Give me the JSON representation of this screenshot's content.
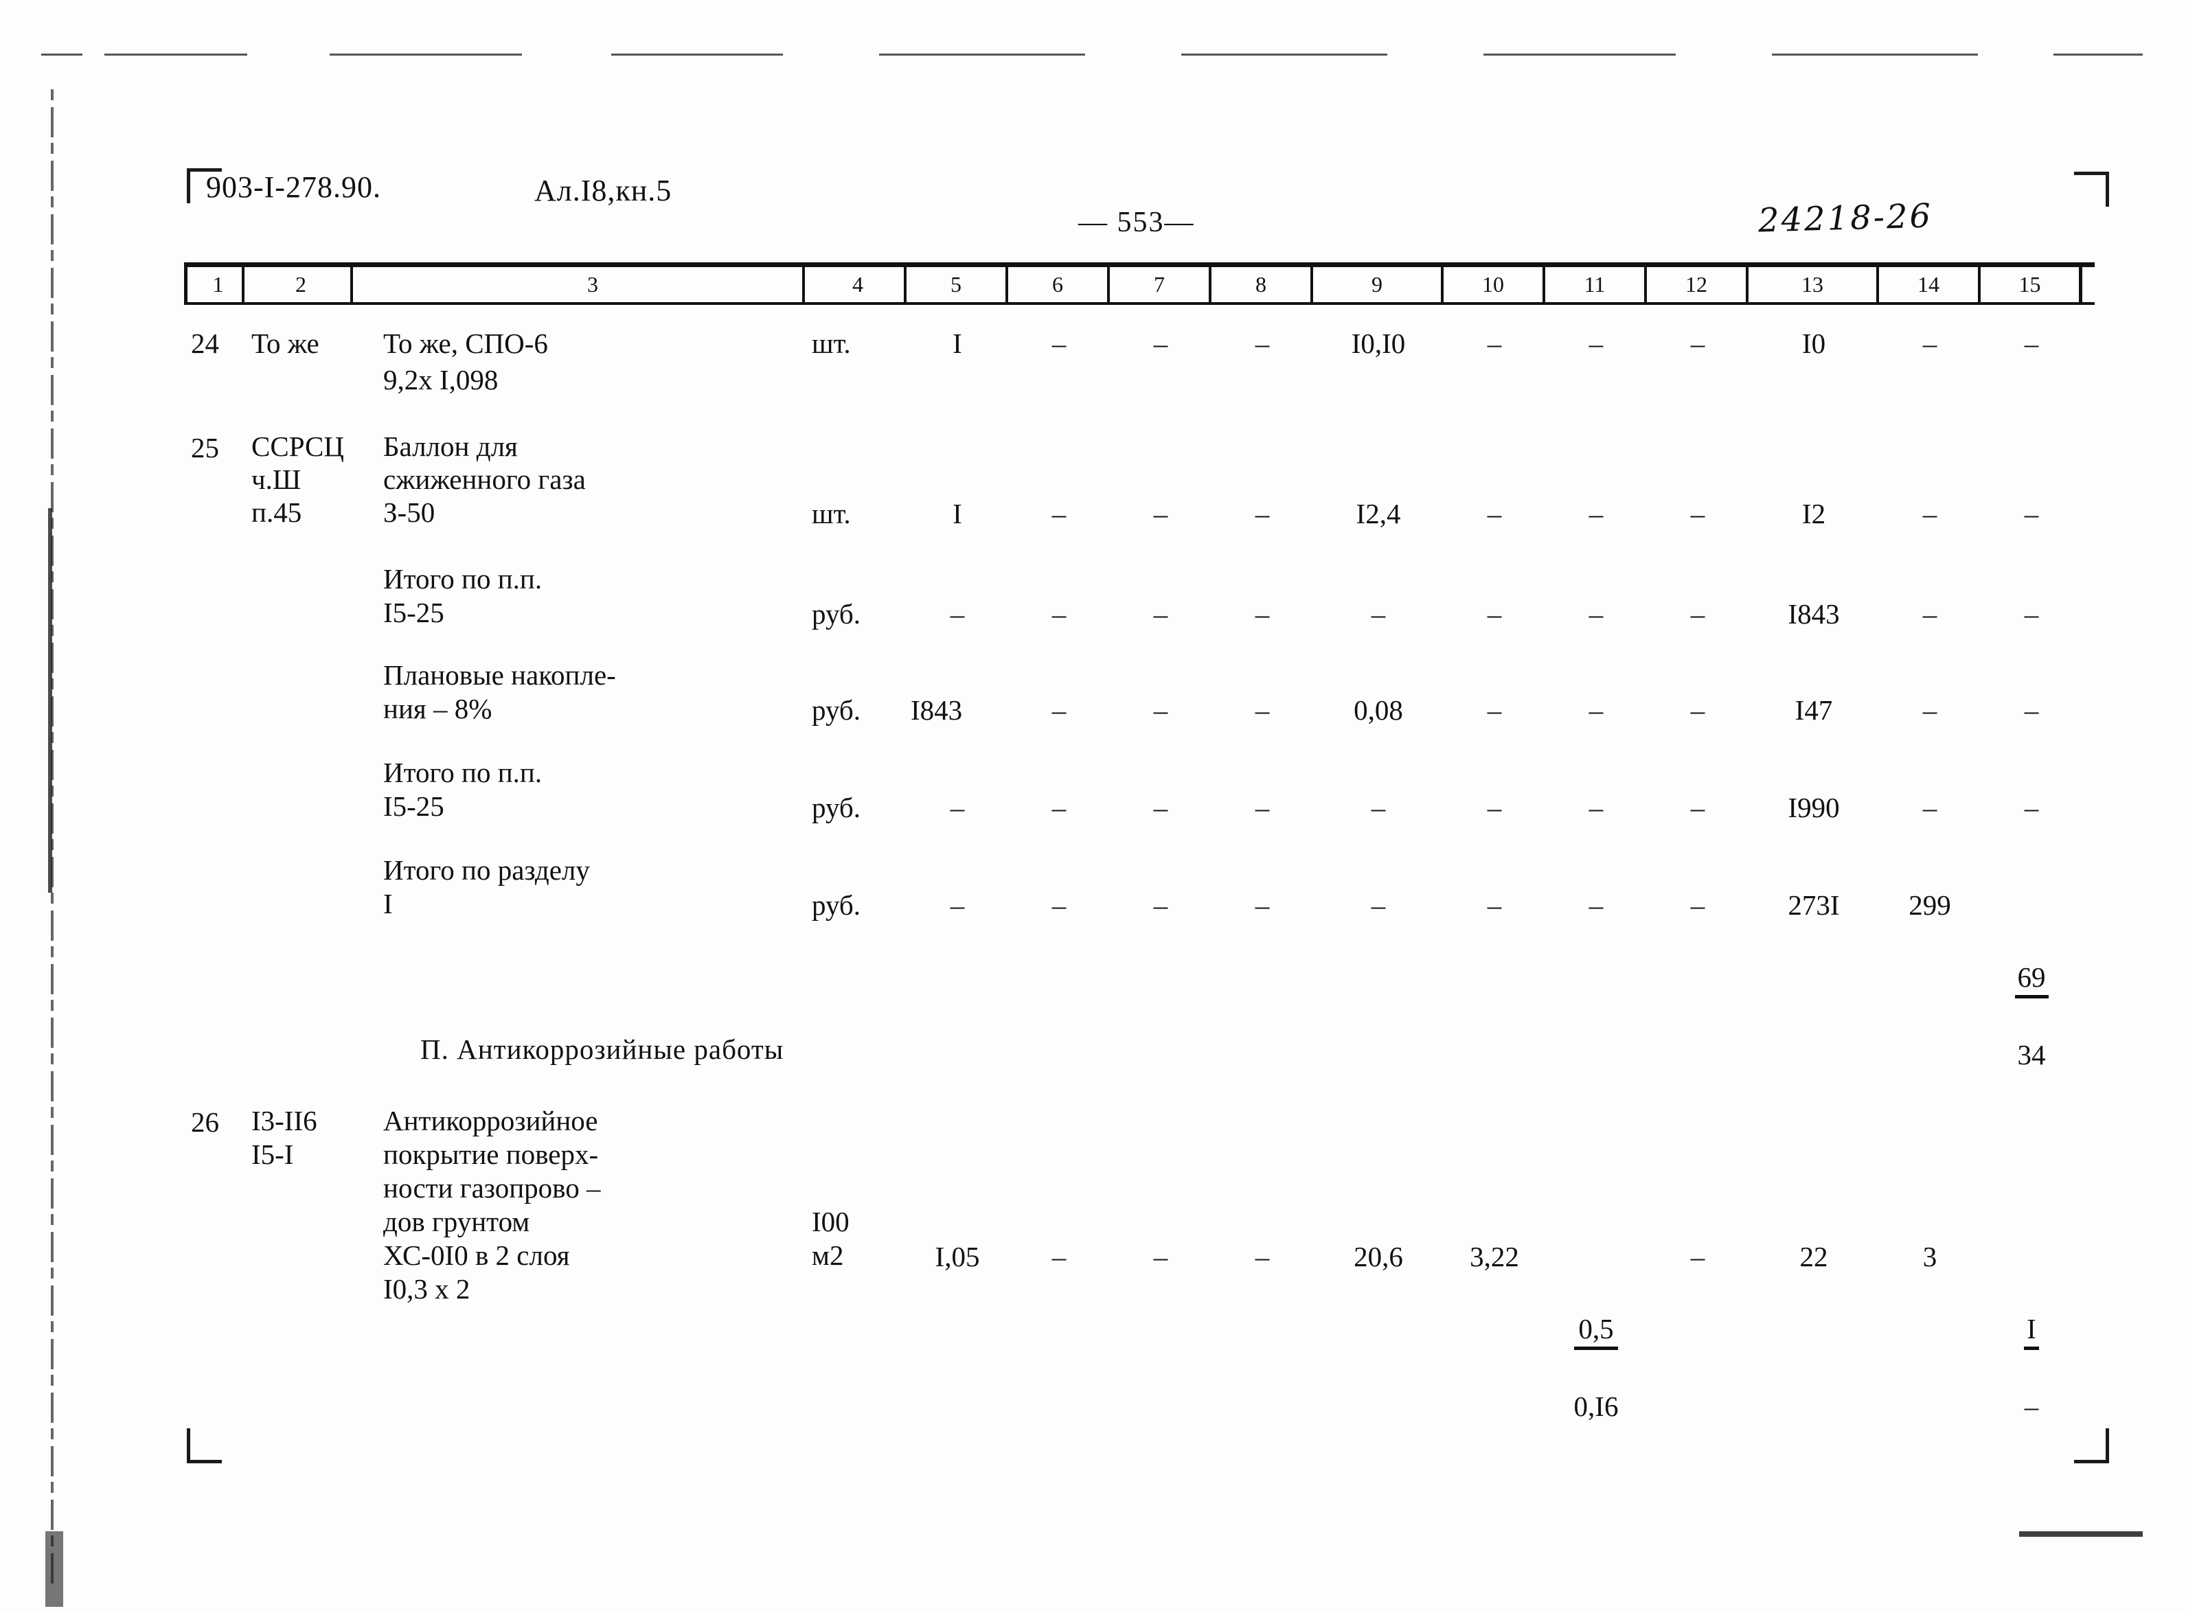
{
  "header": {
    "doc_code": "903-I-278.90.",
    "album_ref": "Ал.I8,кн.5",
    "page_number": "— 553—",
    "archive_number": "24218-26"
  },
  "table": {
    "column_headers": [
      "1",
      "2",
      "3",
      "4",
      "5",
      "6",
      "7",
      "8",
      "9",
      "10",
      "11",
      "12",
      "13",
      "14",
      "15"
    ],
    "rows": [
      {
        "name": "row-24",
        "c1": "24",
        "c2": "То же",
        "c3": "То же, СПО-6\n  9,2х I,098",
        "c4": "шт.",
        "c5": "I",
        "c6": "–",
        "c7": "–",
        "c8": "–",
        "c9": "I0,I0",
        "c10": "–",
        "c11": "–",
        "c12": "–",
        "c13": "I0",
        "c14": "–",
        "c15": "–"
      },
      {
        "name": "row-25",
        "c1": "25",
        "c2": "ССРСЦ\nч.Ш\nп.45",
        "c3": "Баллон для\nсжиженного газа\nЗ-50",
        "c4": "шт.",
        "c5": "I",
        "c6": "–",
        "c7": "–",
        "c8": "–",
        "c9": "I2,4",
        "c10": "–",
        "c11": "–",
        "c12": "–",
        "c13": "I2",
        "c14": "–",
        "c15": "–"
      },
      {
        "name": "row-itogo-15-25-a",
        "c1": "",
        "c2": "",
        "c3": "Итого по п.п.\n    I5-25",
        "c4": "руб.",
        "c5": "–",
        "c6": "–",
        "c7": "–",
        "c8": "–",
        "c9": "–",
        "c10": "–",
        "c11": "–",
        "c12": "–",
        "c13": "I843",
        "c14": "–",
        "c15": "–"
      },
      {
        "name": "row-planovye-nakopleniya",
        "c1": "",
        "c2": "",
        "c3": "Плановые накопле-\nния – 8%",
        "c4": "руб.",
        "c5": "I843",
        "c6": "–",
        "c7": "–",
        "c8": "–",
        "c9": "0,08",
        "c10": "–",
        "c11": "–",
        "c12": "–",
        "c13": "I47",
        "c14": "–",
        "c15": "–"
      },
      {
        "name": "row-itogo-15-25-b",
        "c1": "",
        "c2": "",
        "c3": "Итого по п.п.\n    I5-25",
        "c4": "руб.",
        "c5": "–",
        "c6": "–",
        "c7": "–",
        "c8": "–",
        "c9": "–",
        "c10": "–",
        "c11": "–",
        "c12": "–",
        "c13": "I990",
        "c14": "–",
        "c15": "–"
      },
      {
        "name": "row-itogo-po-razdelu",
        "c1": "",
        "c2": "",
        "c3": "Итого по разделу\n        I",
        "c4": "руб.",
        "c5": "–",
        "c6": "–",
        "c7": "–",
        "c8": "–",
        "c9": "–",
        "c10": "–",
        "c11": "–",
        "c12": "–",
        "c13": "273I",
        "c14": "299",
        "c15_num": "69",
        "c15_den": "34"
      }
    ],
    "section_heading": "П. Антикоррозийные работы",
    "row_26": {
      "name": "row-26",
      "c1": "26",
      "c2": "I3-II6\nI5-I",
      "c3": "Антикоррозийное\nпокрытие поверх-\nности газопрово –\nдов грунтом\nХС-0I0 в 2 слоя\n   I0,3 х 2",
      "c4": "I00\nм2",
      "c5": "I,05",
      "c6": "–",
      "c7": "–",
      "c8": "–",
      "c9": "20,6",
      "c10": "3,22",
      "c11_num": "0,5",
      "c11_den": "0,I6",
      "c12": "–",
      "c13": "22",
      "c14": "3",
      "c15_num": "I",
      "c15_den": "–"
    }
  }
}
